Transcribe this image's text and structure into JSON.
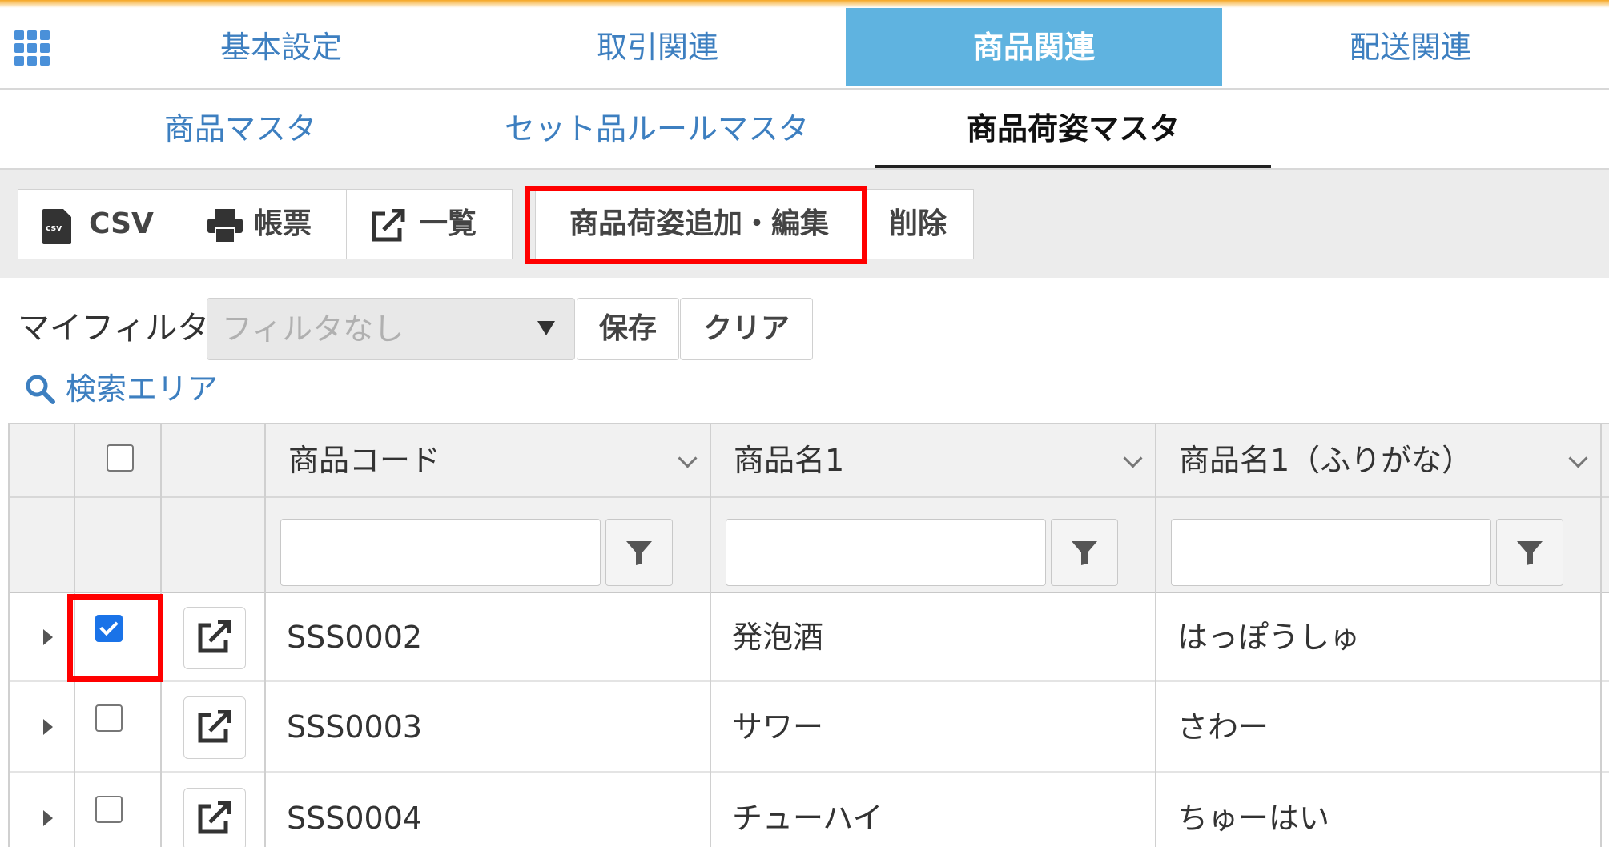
{
  "main_tabs": [
    {
      "label": "基本設定"
    },
    {
      "label": "取引関連"
    },
    {
      "label": "商品関連"
    },
    {
      "label": "配送関連"
    }
  ],
  "sub_tabs": [
    {
      "label": "商品マスタ"
    },
    {
      "label": "セット品ルールマスタ"
    },
    {
      "label": "商品荷姿マスタ"
    }
  ],
  "toolbar": {
    "csv_label": "CSV",
    "csv_icon_text": "csv",
    "report_label": "帳票",
    "list_label": "一覧",
    "add_edit_label": "商品荷姿追加・編集",
    "delete_label": "削除"
  },
  "filter": {
    "label": "マイフィルタ",
    "selected": "フィルタなし",
    "save_label": "保存",
    "clear_label": "クリア"
  },
  "search_area_label": "検索エリア",
  "grid": {
    "columns": [
      "商品コード",
      "商品名1",
      "商品名1（ふりがな）"
    ],
    "rows": [
      {
        "code": "SSS0002",
        "name": "発泡酒",
        "furigana": "はっぽうしゅ",
        "checked": true
      },
      {
        "code": "SSS0003",
        "name": "サワー",
        "furigana": "さわー",
        "checked": false
      },
      {
        "code": "SSS0004",
        "name": "チューハイ",
        "furigana": "ちゅーはい",
        "checked": false
      }
    ]
  },
  "colors": {
    "accent_blue": "#5fb3e0",
    "link_blue": "#3d7fc0",
    "highlight_red": "#ff0000",
    "checkbox_blue": "#1a73e8"
  }
}
